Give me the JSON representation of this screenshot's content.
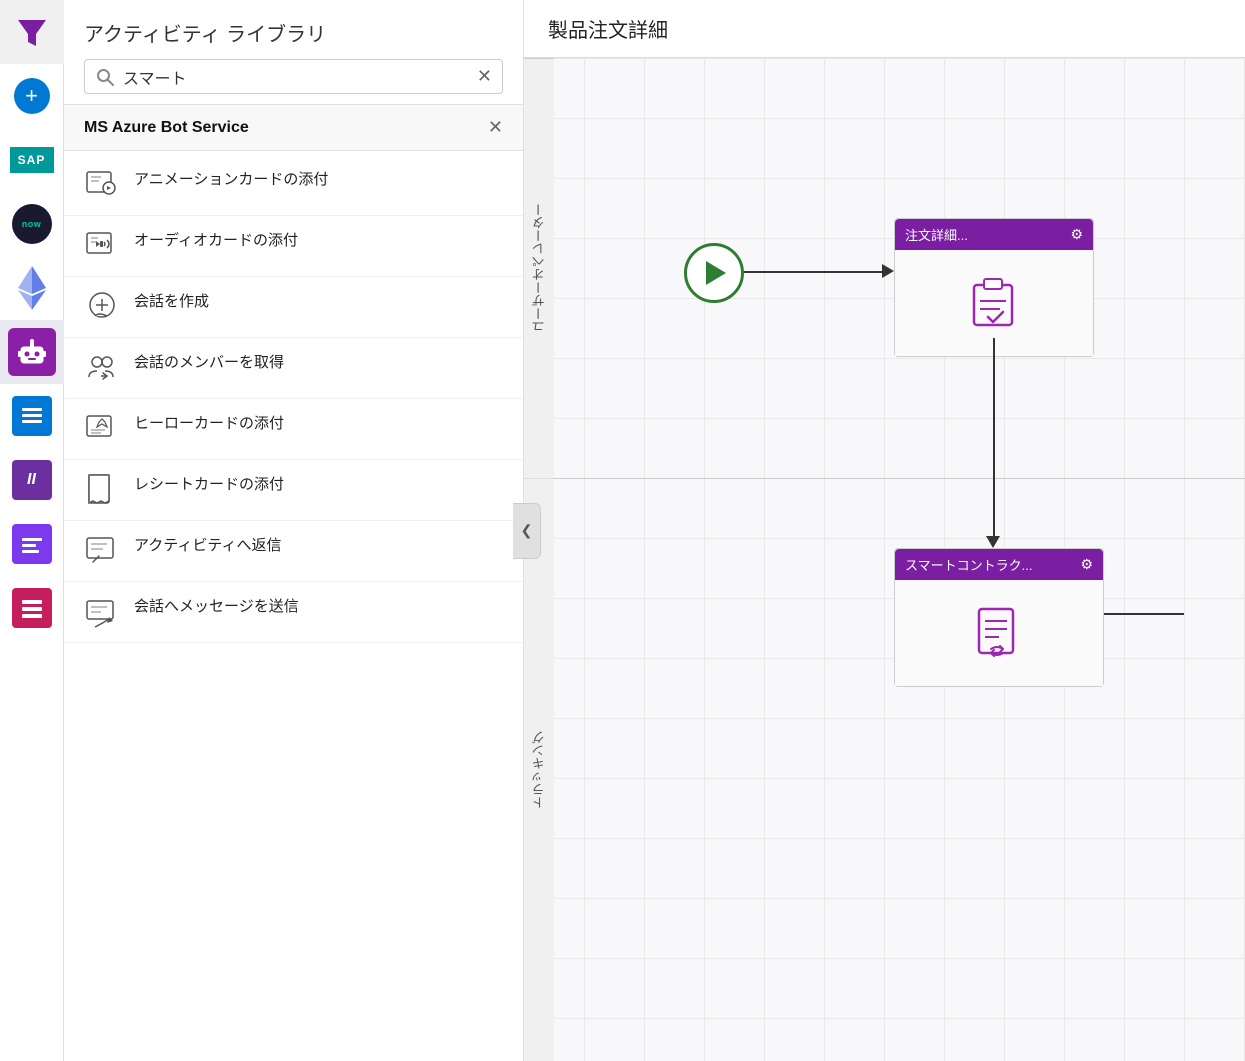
{
  "sidebar": {
    "icons": [
      {
        "name": "filter-icon",
        "type": "funnel",
        "active": false
      },
      {
        "name": "add-icon",
        "type": "plus",
        "active": false
      },
      {
        "name": "sap-icon",
        "type": "sap",
        "active": false
      },
      {
        "name": "now-icon",
        "type": "now",
        "active": false
      },
      {
        "name": "eth-icon",
        "type": "ethereum",
        "active": false
      },
      {
        "name": "robot-icon",
        "type": "robot",
        "active": true
      },
      {
        "name": "list-icon",
        "type": "list",
        "active": false
      },
      {
        "name": "roman-icon",
        "type": "roman",
        "active": false
      },
      {
        "name": "bar-icon",
        "type": "bar",
        "active": false
      },
      {
        "name": "pink-icon",
        "type": "pink",
        "active": false
      }
    ]
  },
  "activity_panel": {
    "title": "アクティビティ ライブラリ",
    "search": {
      "value": "スマート",
      "placeholder": "スマート"
    },
    "service": {
      "name": "MS Azure Bot Service"
    },
    "items": [
      {
        "label": "アニメーションカードの添付",
        "icon": "animation-card-icon"
      },
      {
        "label": "オーディオカードの添付",
        "icon": "audio-card-icon"
      },
      {
        "label": "会話を作成",
        "icon": "create-conversation-icon"
      },
      {
        "label": "会話のメンバーを取得",
        "icon": "get-members-icon"
      },
      {
        "label": "ヒーローカードの添付",
        "icon": "hero-card-icon"
      },
      {
        "label": "レシートカードの添付",
        "icon": "receipt-card-icon"
      },
      {
        "label": "アクティビティへ返信",
        "icon": "reply-activity-icon"
      },
      {
        "label": "会話へメッセージを送信",
        "icon": "send-message-icon"
      }
    ]
  },
  "canvas": {
    "title": "製品注文詳細",
    "swimlanes": [
      {
        "label": "ユーザーオペレーター"
      },
      {
        "label": "トラッキング"
      }
    ],
    "nodes": [
      {
        "id": "start",
        "type": "start"
      },
      {
        "id": "node1",
        "type": "activity",
        "label": "注文詳細...",
        "icon": "clipboard-check-icon"
      },
      {
        "id": "node2",
        "type": "activity",
        "label": "スマートコントラク...",
        "icon": "contract-sync-icon"
      }
    ]
  },
  "icons": {
    "gear": "⚙",
    "search": "🔍",
    "close": "✕",
    "chevron_left": "❮",
    "play": "▶"
  }
}
